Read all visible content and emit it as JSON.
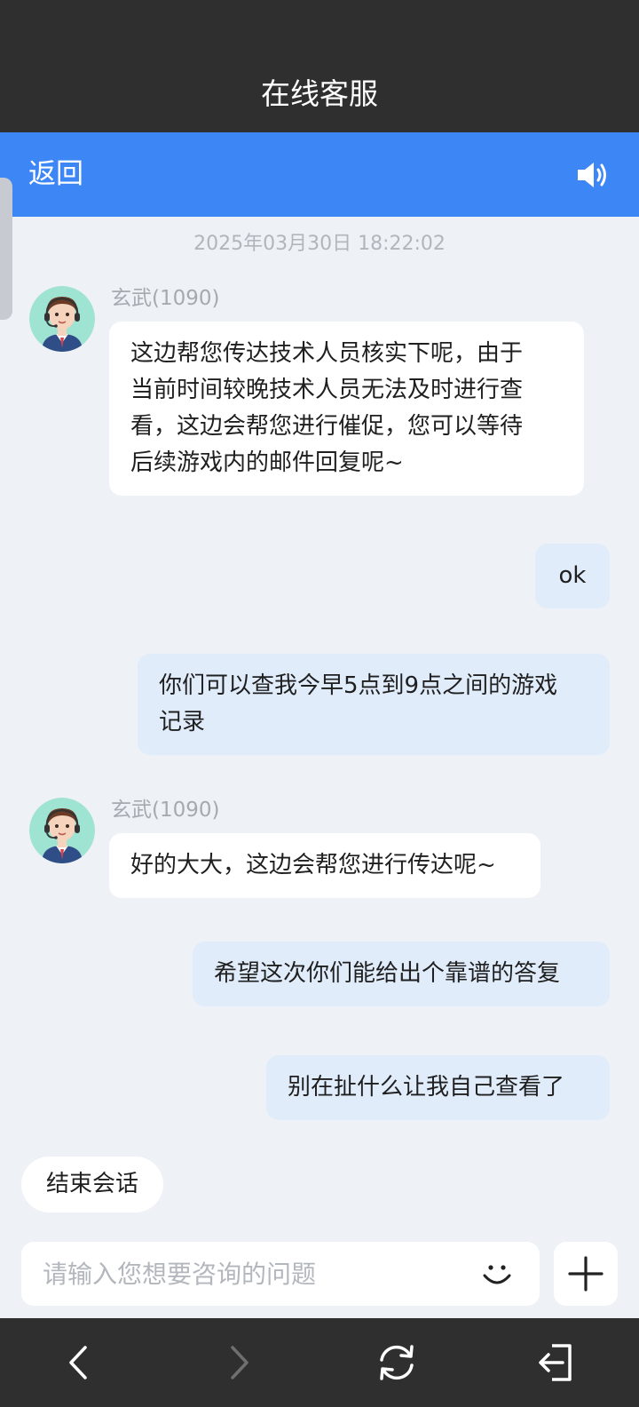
{
  "header": {
    "title": "在线客服"
  },
  "nav": {
    "back_label": "返回",
    "sound_icon": "speaker-icon"
  },
  "chat": {
    "timestamp": "2025年03月30日 18:22:02",
    "messages": [
      {
        "sender": "agent",
        "name": "玄武(1090)",
        "text": "这边帮您传达技术人员核实下呢，由于\n当前时间较晚技术人员无法及时进行查\n看，这边会帮您进行催促，您可以等待\n后续游戏内的邮件回复呢~"
      },
      {
        "sender": "user",
        "text": "ok"
      },
      {
        "sender": "user",
        "text": "你们可以查我今早5点到9点之间的游戏\n记录"
      },
      {
        "sender": "agent",
        "name": "玄武(1090)",
        "text": "好的大大，这边会帮您进行传达呢~"
      },
      {
        "sender": "user",
        "text": "希望这次你们能给出个靠谱的答复"
      },
      {
        "sender": "user",
        "text": "别在扯什么让我自己查看了"
      }
    ]
  },
  "end_session_label": "结束会话",
  "input": {
    "placeholder": "请输入您想要咨询的问题",
    "value": ""
  },
  "colors": {
    "accent": "#3d86f6",
    "dark_bar": "#2f2f2f",
    "background": "#eef1f5",
    "user_bubble": "#e1ecfb",
    "agent_bubble": "#ffffff"
  },
  "icons": [
    "speaker-icon",
    "smiley-icon",
    "plus-icon",
    "back-arrow-icon",
    "forward-arrow-icon",
    "refresh-icon",
    "exit-icon"
  ]
}
